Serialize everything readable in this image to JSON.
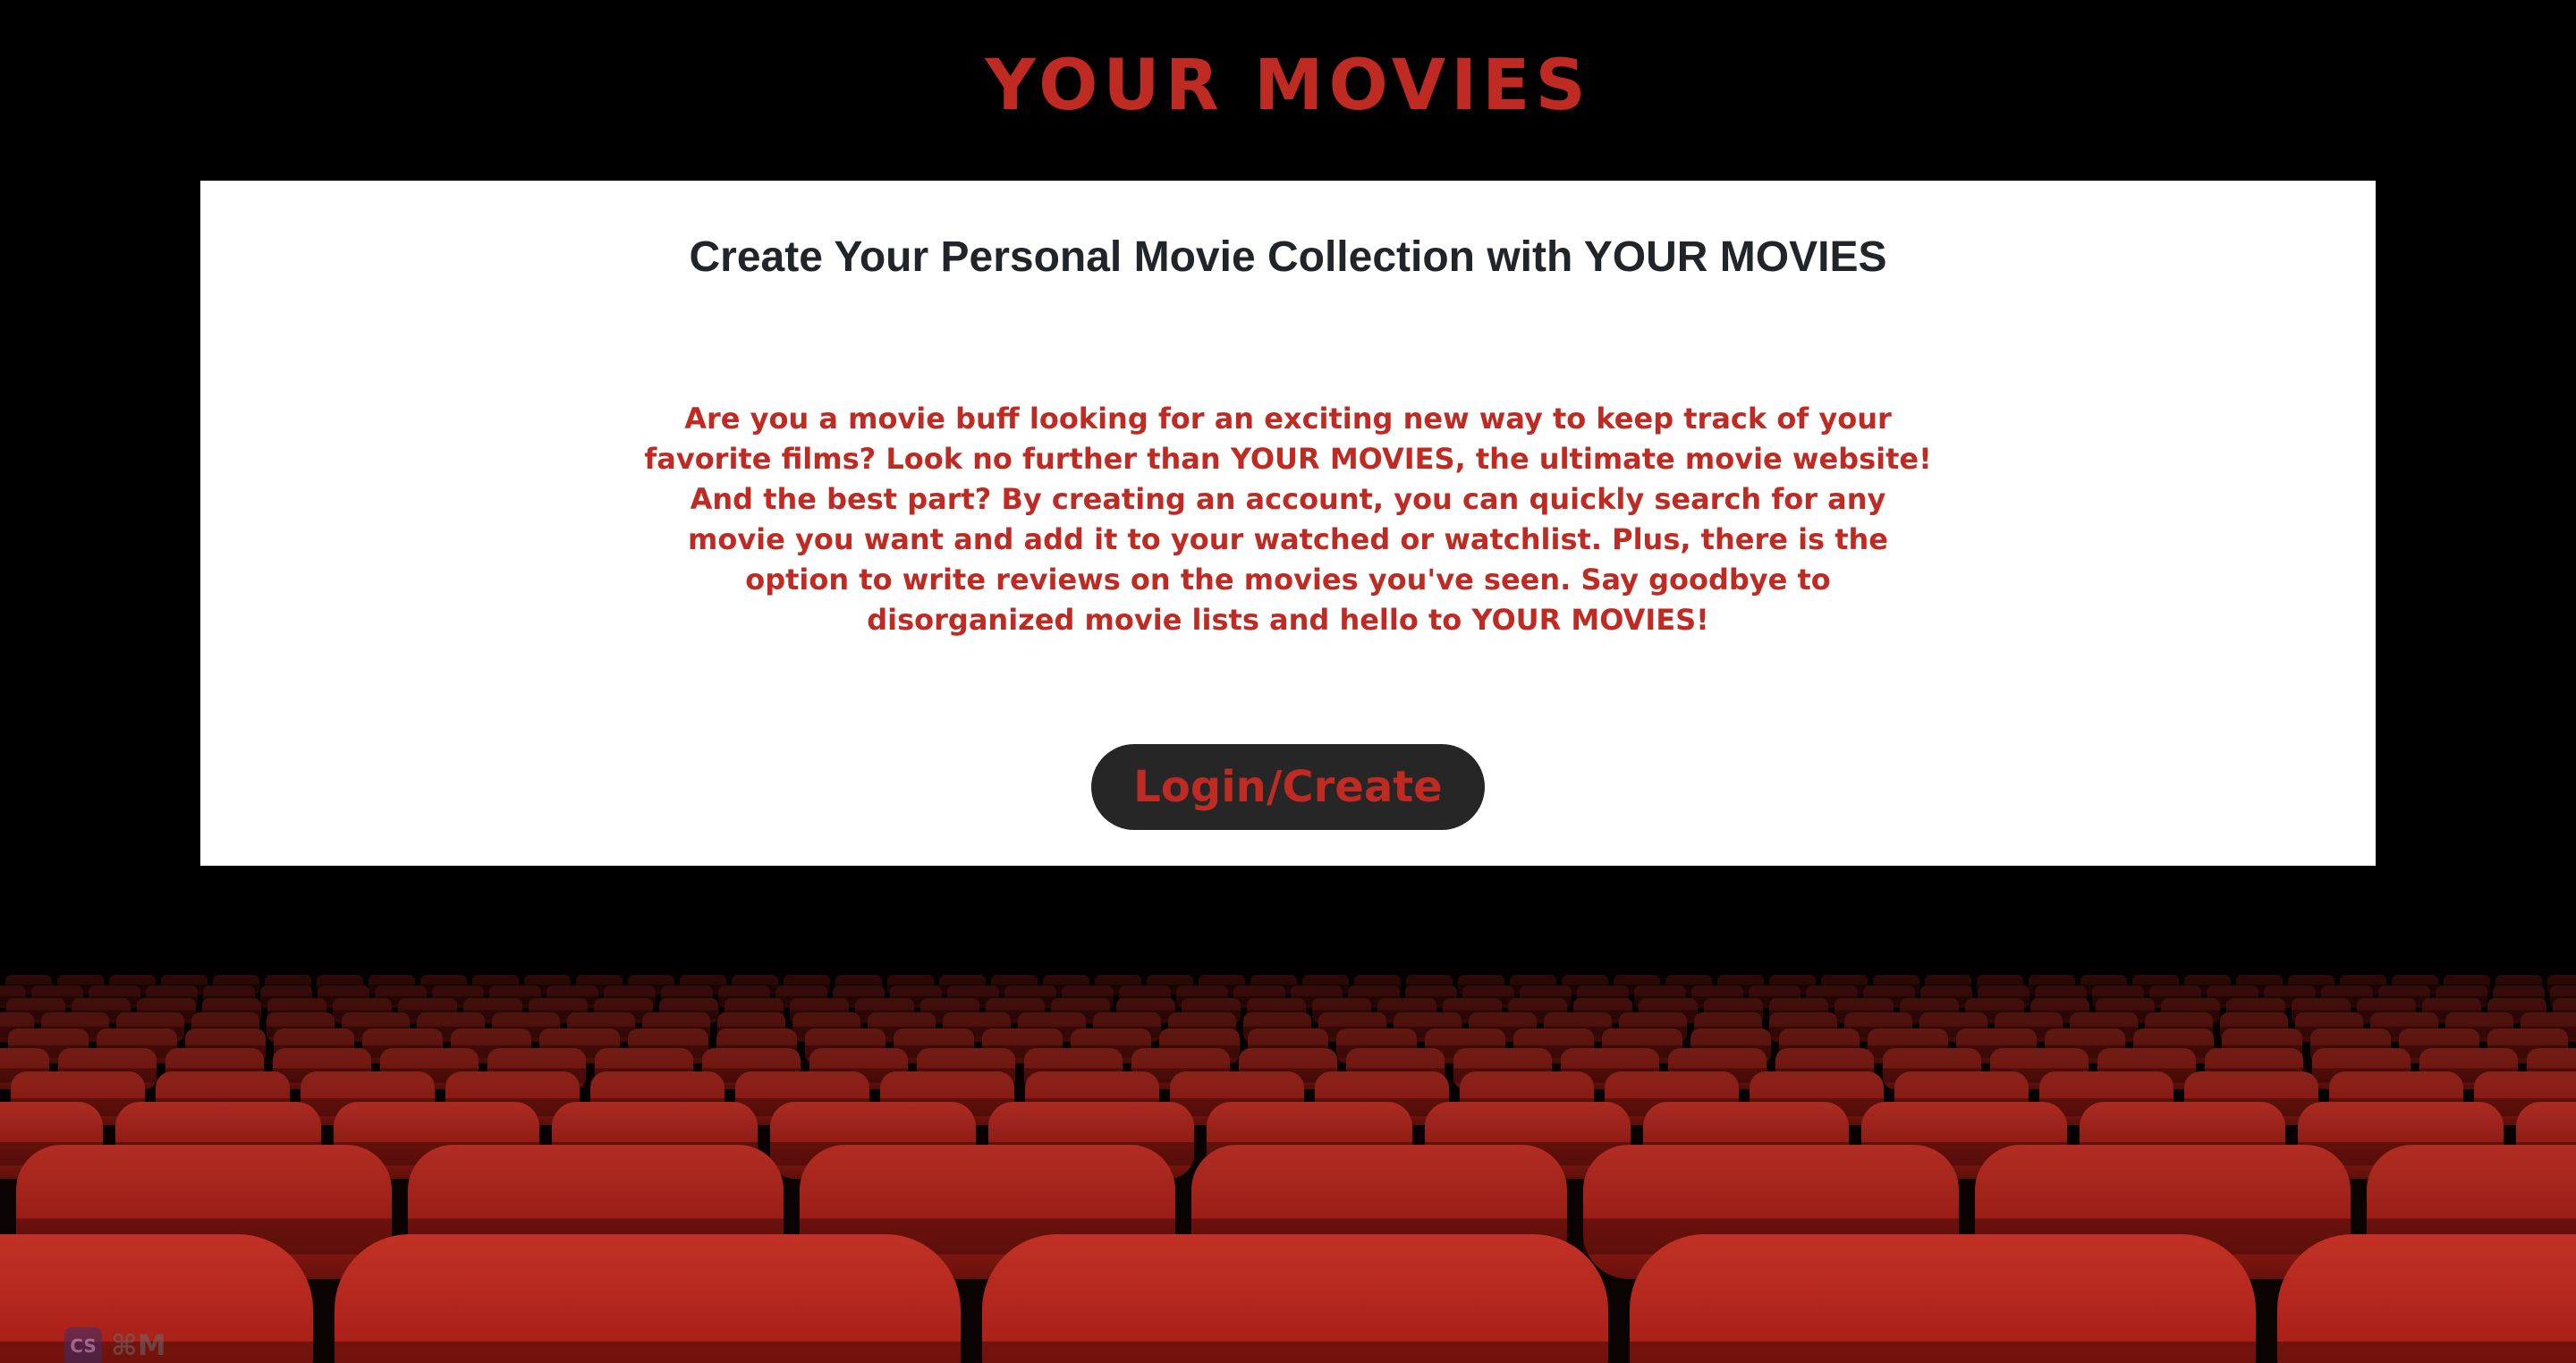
{
  "header": {
    "brand": "YOUR MOVIES"
  },
  "panel": {
    "heading": "Create Your Personal Movie Collection with YOUR MOVIES",
    "description": "Are you a movie buff looking for an exciting new way to keep track of your favorite films? Look no further than YOUR MOVIES, the ultimate movie website! And the best part? By creating an account, you can quickly search for any movie you want and add it to your watched or watchlist. Plus, there is the option to write reviews on the movies you've seen. Say goodbye to disorganized movie lists and hello to YOUR MOVIES!",
    "login_button": "Login/Create"
  },
  "badge": {
    "icon_text": "CS",
    "shortcut": "⌘M"
  },
  "colors": {
    "accent": "#bf2a22",
    "background": "#000000",
    "panel": "#ffffff",
    "button": "#262626",
    "seat": "#b3231a"
  },
  "icons": {
    "badge": "extension-icon"
  }
}
